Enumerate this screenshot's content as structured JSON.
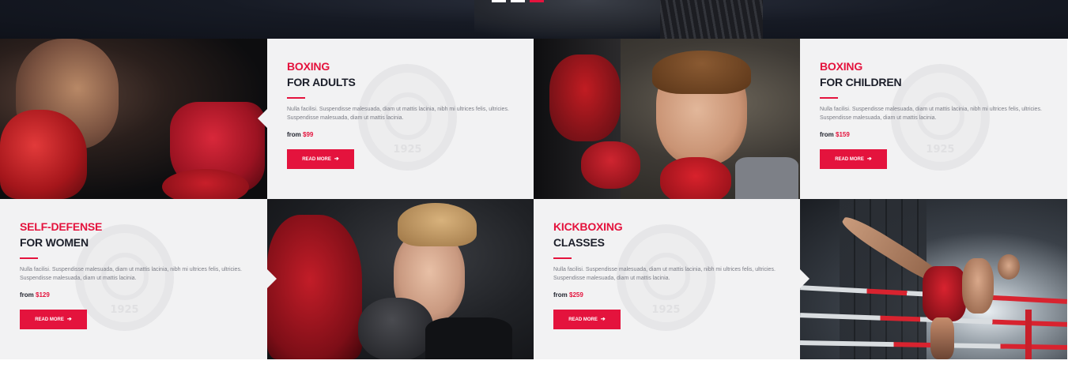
{
  "hero": {
    "slider_dots": 3,
    "active_dot": 2
  },
  "colors": {
    "accent": "#e4133d",
    "heading": "#1c1f2a",
    "card_bg": "#f2f2f3",
    "body_text": "#7b7d86"
  },
  "programs": [
    {
      "title": "BOXING",
      "subtitle": "FOR ADULTS",
      "description": "Nulla facilisi. Suspendisse malesuada, diam ut mattis lacinia, nibh mi ultrices felis, ultricies. Suspendisse malesuada, diam ut mattis lacinia.",
      "price_label": "from",
      "price": "$99",
      "button_label": "READ MORE",
      "emblem_year": "1925"
    },
    {
      "title": "BOXING",
      "subtitle": "FOR CHILDREN",
      "description": "Nulla facilisi. Suspendisse malesuada, diam ut mattis lacinia, nibh mi ultrices felis, ultricies. Suspendisse malesuada, diam ut mattis lacinia.",
      "price_label": "from",
      "price": "$159",
      "button_label": "READ MORE",
      "emblem_year": "1925"
    },
    {
      "title": "SELF-DEFENSE",
      "subtitle": "FOR WOMEN",
      "description": "Nulla facilisi. Suspendisse malesuada, diam ut mattis lacinia, nibh mi ultrices felis, ultricies. Suspendisse malesuada, diam ut mattis lacinia.",
      "price_label": "from",
      "price": "$129",
      "button_label": "READ MORE",
      "emblem_year": "1925"
    },
    {
      "title": "KICKBOXING",
      "subtitle": "CLASSES",
      "description": "Nulla facilisi. Suspendisse malesuada, diam ut mattis lacinia, nibh mi ultrices felis, ultricies. Suspendisse malesuada, diam ut mattis lacinia.",
      "price_label": "from",
      "price": "$259",
      "button_label": "READ MORE",
      "emblem_year": "1925"
    }
  ],
  "icons": {
    "button_arrow": "arrow-right-icon"
  }
}
